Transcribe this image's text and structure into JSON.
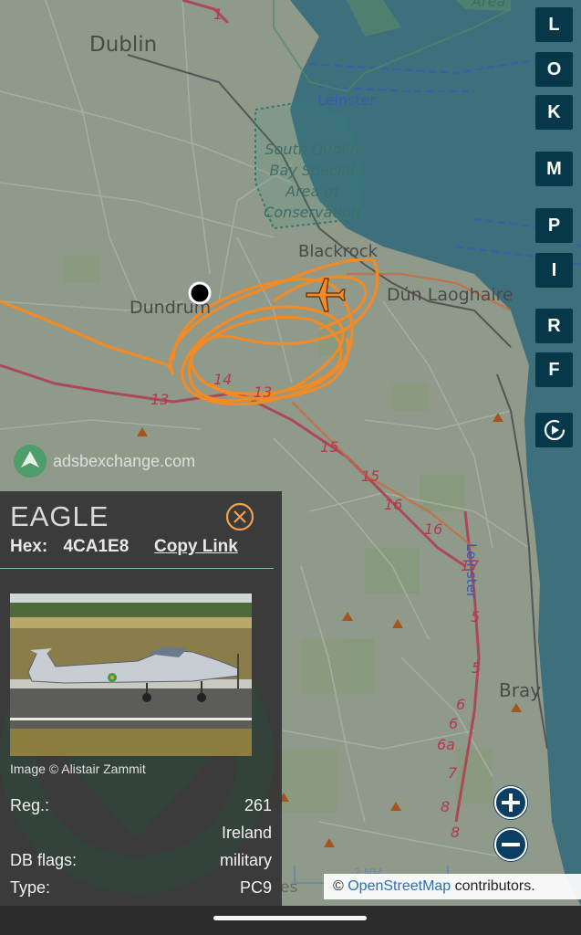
{
  "map": {
    "places": {
      "dublin": "Dublin",
      "dundrum": "Dundrum",
      "blackrock": "Blackrock",
      "dun_laoghaire": "Dún Laoghaire",
      "bray": "Bray",
      "leinster_top": "Leinster",
      "leinster_side": "Leinster",
      "area_top": "Area",
      "partial_bottom": "es"
    },
    "water_area": [
      "South Dublin",
      "Bay Special",
      "Area of",
      "Conservation"
    ],
    "road_numbers": [
      "1",
      "13",
      "14",
      "13",
      "15",
      "15",
      "16",
      "16",
      "17",
      "5",
      "5",
      "6",
      "6",
      "6a",
      "7",
      "8",
      "8"
    ],
    "watermark": "adsbexchange.com",
    "scale_label": "2 NM",
    "attribution": {
      "prefix": "© ",
      "link": "OpenStreetMap",
      "suffix": " contributors."
    },
    "colors": {
      "track": "#f28a26",
      "aircraft": "#f28a26",
      "button_bg": "#07384a",
      "zoom_bg": "#0a3f63",
      "land": "#8f9a8b",
      "water": "#3d6f7d"
    }
  },
  "sidebar_buttons": [
    "L",
    "O",
    "K",
    "M",
    "P",
    "I",
    "R",
    "F"
  ],
  "sidebar_replay_icon": "replay-icon",
  "zoom": {
    "in_icon": "plus-icon",
    "out_icon": "minus-icon"
  },
  "panel": {
    "callsign": "EAGLE",
    "hex_label": "Hex:",
    "hex_value": "4CA1E8",
    "copy_link": "Copy Link",
    "image_credit": "Image © Alistair Zammit",
    "rows": [
      {
        "label": "Reg.:",
        "value": "261"
      },
      {
        "label": "",
        "value": "Ireland"
      },
      {
        "label": "DB flags:",
        "value": "military"
      },
      {
        "label": "Type:",
        "value": "PC9"
      }
    ]
  }
}
